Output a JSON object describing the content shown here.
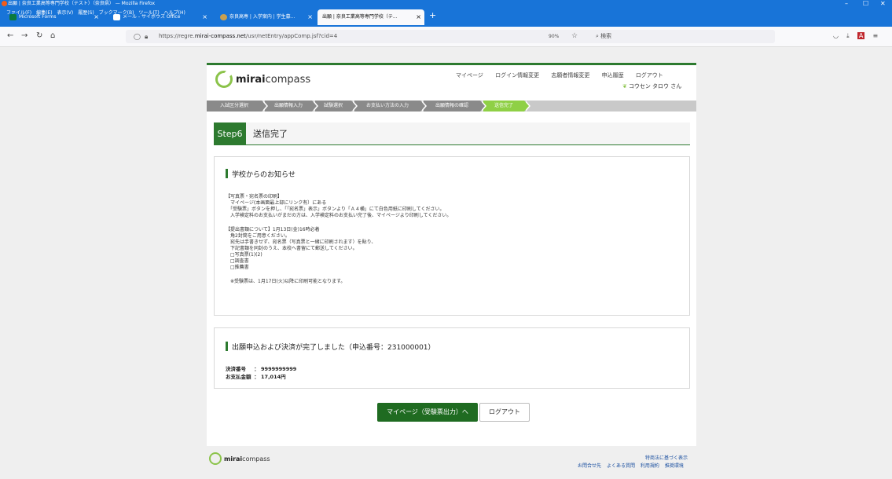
{
  "browser": {
    "window_title": "出願 | 奈良工業高等専門学校（テスト）（奈良県） — Mozilla Firefox",
    "menus": [
      "ファイル(F)",
      "編集(E)",
      "表示(V)",
      "履歴(S)",
      "ブックマーク(B)",
      "ツール(T)",
      "ヘルプ(H)"
    ],
    "tabs": [
      {
        "label": "Microsoft Forms"
      },
      {
        "label": "メール - サイボウズ Office"
      },
      {
        "label": "奈良高専 | 入学案内 | 学生募..."
      },
      {
        "label": "出願 | 奈良工業高等専門学校（テ..."
      }
    ],
    "url_prefix": "https://regre.",
    "url_host": "mirai-compass.net",
    "url_path": "/usr/netEntry/appComp.jsf?cid=4",
    "zoom": "90%",
    "search_placeholder": "検索"
  },
  "header": {
    "logo_bold": "mirai",
    "logo_rest": "compass",
    "links": [
      "マイページ",
      "ログイン情報変更",
      "志願者情報変更",
      "申込履歴",
      "ログアウト"
    ],
    "username": "コウセン タロウ さん"
  },
  "steps": [
    "入試区分選択",
    "出願情報入力",
    "試験選択",
    "お支払い方法の入力",
    "出願情報の確認",
    "送信完了"
  ],
  "step_title": {
    "badge": "Step6",
    "title": "送信完了"
  },
  "notice": {
    "heading": "学校からのお知らせ",
    "lines": [
      "【写真票・宛名票の印刷】",
      "　マイページ(本画面最上部にリンク有）にある",
      "　「受験票」ボタンを押し、「「宛名票」表示」ボタンより「Ａ４横」にて白色用紙に印刷してください。",
      "　入学検定料のお支払いがまだの方は、入学検定料のお支払い完了後、マイページより印刷してください。",
      "",
      "【提出書類について】1月13日(金)16時必着",
      "　角2封筒をご用意ください。",
      "　宛先は手書きせず、宛名票（写真票と一緒に印刷されます）を貼り、",
      "　下記書類を同封のうえ、本校へ書留にて郵送してください。",
      "　□写真票(1)(2)",
      "　□調査書",
      "　□推薦書",
      "",
      "　※受験票は、1月17日(火)以降に印刷可能となります。"
    ]
  },
  "result": {
    "heading": "出願申込および決済が完了しました（申込番号：231000001）",
    "payment_no_label": "決済番号",
    "payment_no_value": "：  9999999999",
    "amount_label": "お支払金額",
    "amount_value": "：  17,014円"
  },
  "buttons": {
    "mypage": "マイページ（受験票出力）へ",
    "logout": "ログアウト"
  },
  "footer": {
    "logo_bold": "mirai",
    "logo_rest": "compass",
    "links_row1": [
      "特商法に基づく表示"
    ],
    "links_row2": [
      "お問合せ先",
      "よくある質問",
      "利用規約",
      "推奨環境"
    ]
  }
}
